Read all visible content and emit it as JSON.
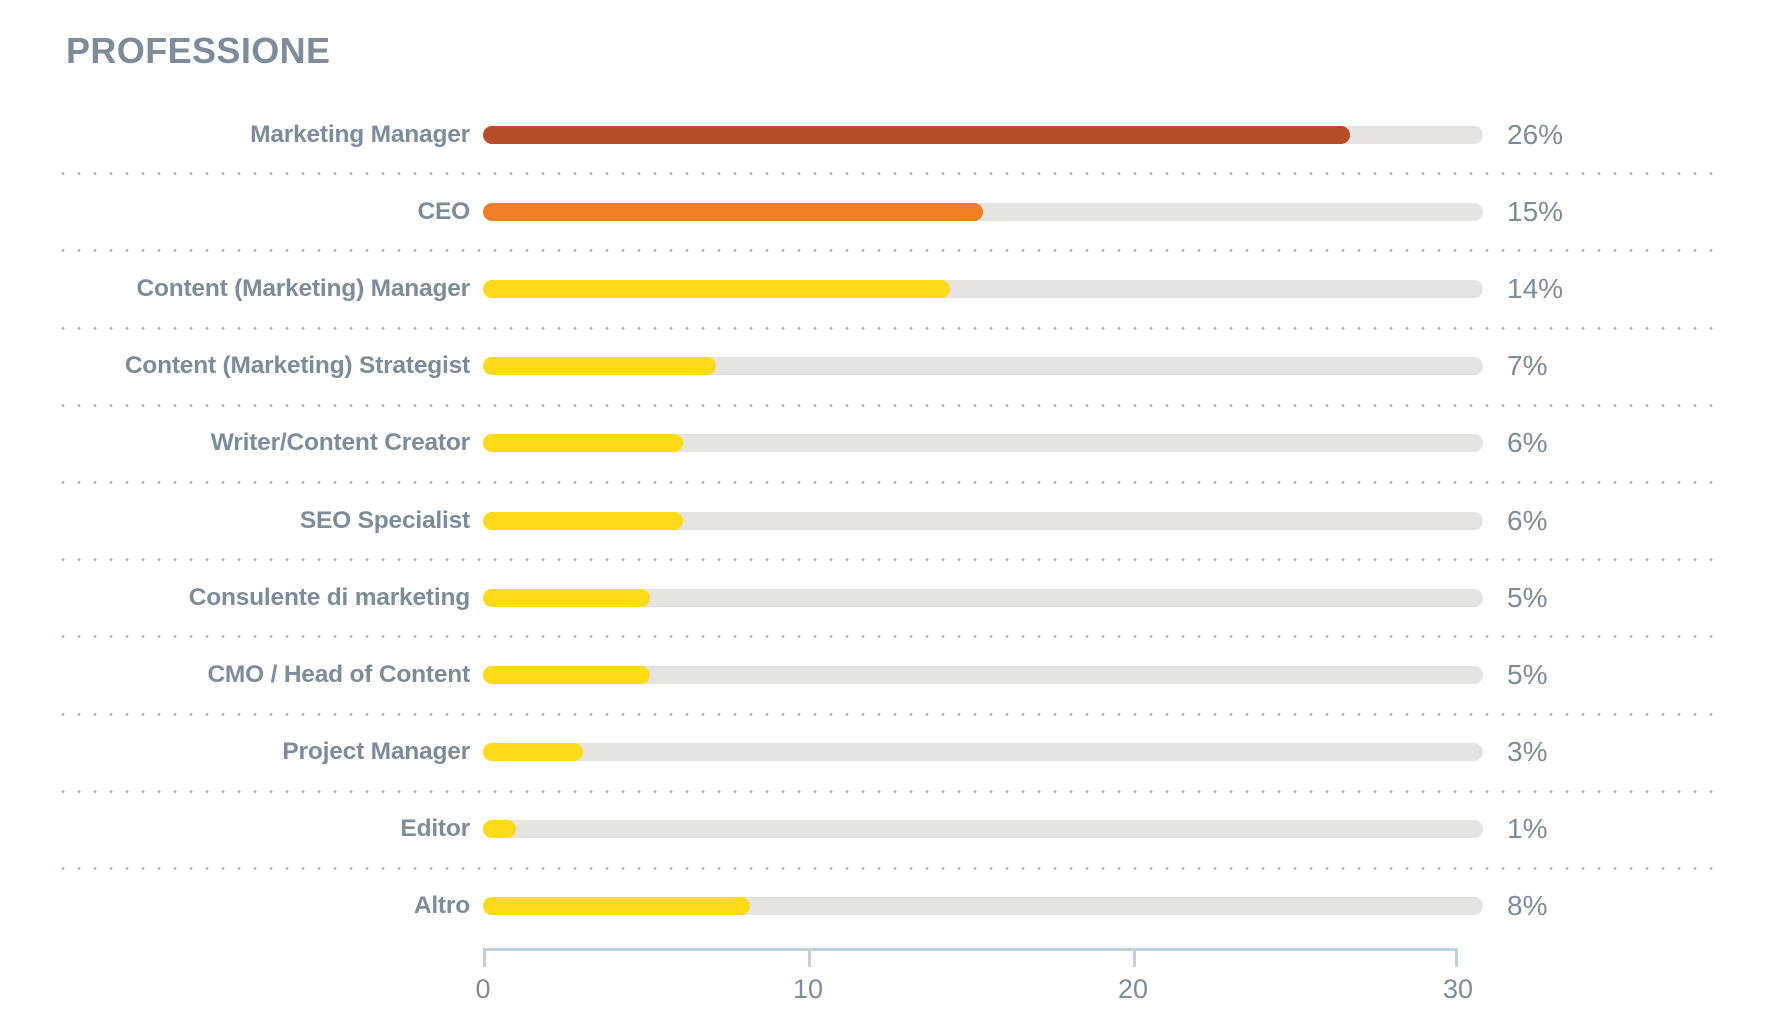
{
  "chart": {
    "title": "PROFESSIONE"
  },
  "axis": {
    "ticks": [
      {
        "value": 0,
        "label": "0"
      },
      {
        "value": 10,
        "label": "10"
      },
      {
        "value": 20,
        "label": "20"
      },
      {
        "value": 30,
        "label": "30"
      }
    ]
  },
  "colors": {
    "bar_rust": "#b84d27",
    "bar_orange": "#f07e26",
    "bar_yellow": "#fcdb16",
    "track": "#e5e4e2",
    "text": "#7e8c9a",
    "axis": "#c3d0da",
    "dots": "#aebccc"
  },
  "rows": [
    {
      "label": "Marketing Manager",
      "value": 26,
      "value_label": "26%",
      "color": "#b84d27"
    },
    {
      "label": "CEO",
      "value": 15,
      "value_label": "15%",
      "color": "#f07e26"
    },
    {
      "label": "Content (Marketing) Manager",
      "value": 14,
      "value_label": "14%",
      "color": "#fcdb16"
    },
    {
      "label": "Content (Marketing) Strategist",
      "value": 7,
      "value_label": "7%",
      "color": "#fcdb16"
    },
    {
      "label": "Writer/Content Creator",
      "value": 6,
      "value_label": "6%",
      "color": "#fcdb16"
    },
    {
      "label": "SEO Specialist",
      "value": 6,
      "value_label": "6%",
      "color": "#fcdb16"
    },
    {
      "label": "Consulente di marketing",
      "value": 5,
      "value_label": "5%",
      "color": "#fcdb16"
    },
    {
      "label": "CMO / Head of Content",
      "value": 5,
      "value_label": "5%",
      "color": "#fcdb16"
    },
    {
      "label": "Project Manager",
      "value": 3,
      "value_label": "3%",
      "color": "#fcdb16"
    },
    {
      "label": "Editor",
      "value": 1,
      "value_label": "1%",
      "color": "#fcdb16"
    },
    {
      "label": "Altro",
      "value": 8,
      "value_label": "8%",
      "color": "#fcdb16"
    }
  ],
  "chart_data": {
    "type": "bar",
    "orientation": "horizontal",
    "title": "PROFESSIONE",
    "xlabel": "",
    "ylabel": "",
    "xlim": [
      0,
      30
    ],
    "xticks": [
      0,
      10,
      20,
      30
    ],
    "grid": false,
    "legend": null,
    "unit": "%",
    "categories": [
      "Marketing Manager",
      "CEO",
      "Content (Marketing) Manager",
      "Content (Marketing) Strategist",
      "Writer/Content Creator",
      "SEO Specialist",
      "Consulente di marketing",
      "CMO / Head of Content",
      "Project Manager",
      "Editor",
      "Altro"
    ],
    "values": [
      26,
      15,
      14,
      7,
      6,
      6,
      5,
      5,
      3,
      1,
      8
    ],
    "data_labels": [
      "26%",
      "15%",
      "14%",
      "7%",
      "6%",
      "6%",
      "5%",
      "5%",
      "3%",
      "1%",
      "8%"
    ],
    "bar_colors": [
      "#b84d27",
      "#f07e26",
      "#fcdb16",
      "#fcdb16",
      "#fcdb16",
      "#fcdb16",
      "#fcdb16",
      "#fcdb16",
      "#fcdb16",
      "#fcdb16",
      "#fcdb16"
    ]
  }
}
